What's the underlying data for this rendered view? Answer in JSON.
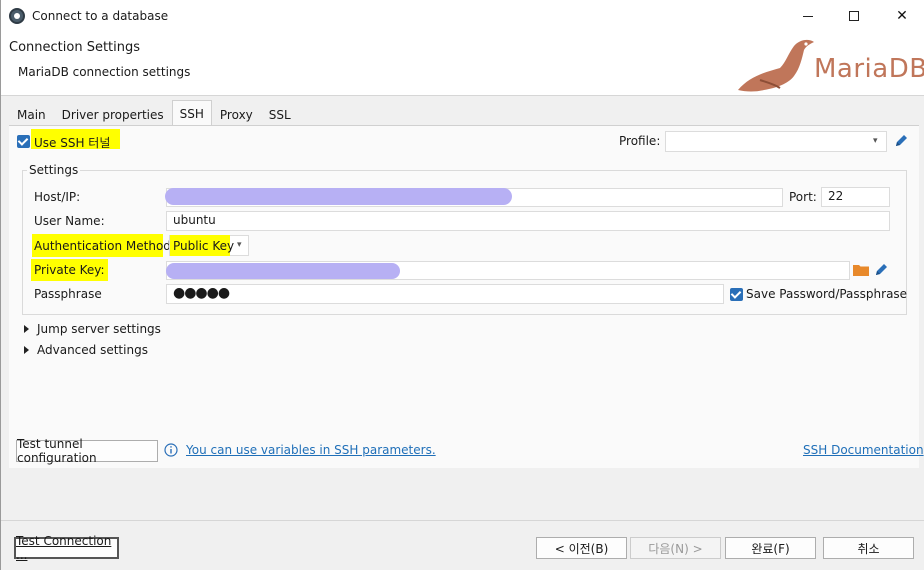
{
  "window": {
    "title": "Connect to a database"
  },
  "header": {
    "title": "Connection Settings",
    "subtitle": "MariaDB connection settings",
    "logo_text": "MariaDB"
  },
  "tabs": [
    {
      "label": "Main",
      "active": false
    },
    {
      "label": "Driver properties",
      "active": false
    },
    {
      "label": "SSH",
      "active": true
    },
    {
      "label": "Proxy",
      "active": false
    },
    {
      "label": "SSL",
      "active": false
    }
  ],
  "ssh": {
    "use_ssh_label": "Use SSH 터널",
    "use_ssh_checked": true,
    "profile_label": "Profile:",
    "profile_value": "",
    "settings_group": "Settings",
    "host_label": "Host/IP:",
    "port_label": "Port:",
    "port_value": "22",
    "user_label": "User Name:",
    "user_value": "ubuntu",
    "auth_label": "Authentication Method:",
    "auth_value": "Public Key",
    "private_key_label": "Private Key:",
    "passphrase_label": "Passphrase",
    "passphrase_value": "●●●●●",
    "save_password_label": "Save Password/Passphrase",
    "save_password_checked": true,
    "jump_server": "Jump server settings",
    "advanced": "Advanced settings",
    "test_tunnel": "Test tunnel configuration",
    "variables_link": "You can use variables in SSH parameters.",
    "ssh_docs": "SSH Documentation"
  },
  "footer": {
    "test_connection": "Test Connection ...",
    "back": "< 이전(B)",
    "next": "다음(N) >",
    "finish": "완료(F)",
    "cancel": "취소"
  },
  "colors": {
    "accent": "#2a6fb8",
    "highlight": "#ffff00",
    "redacted": "#b7b0f4",
    "brand": "#c0765a",
    "folder": "#e8892b"
  }
}
